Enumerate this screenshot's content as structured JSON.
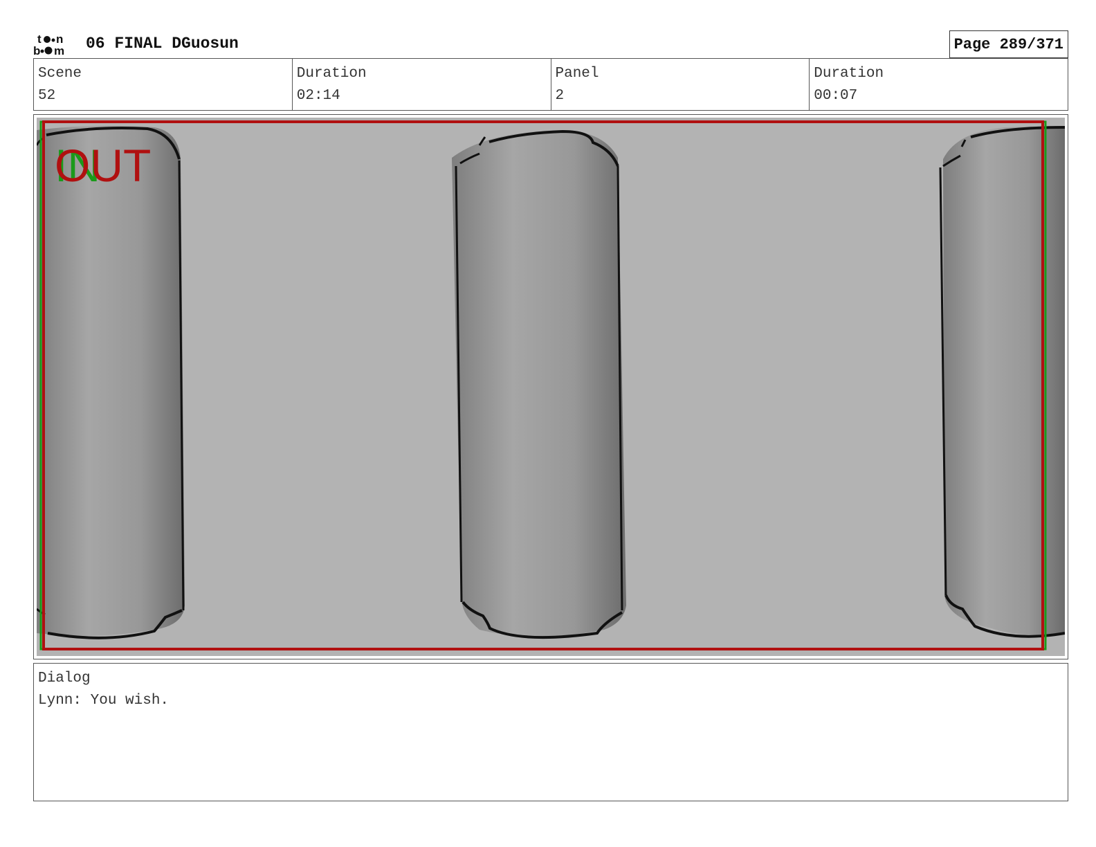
{
  "header": {
    "logo": "toon boom",
    "project_title": "06 FINAL DGuosun",
    "page": "Page 289/371"
  },
  "info": {
    "scene_label": "Scene",
    "scene_value": "52",
    "scene_duration_label": "Duration",
    "scene_duration_value": "02:14",
    "panel_label": "Panel",
    "panel_value": "2",
    "panel_duration_label": "Duration",
    "panel_duration_value": "00:07"
  },
  "panel": {
    "in_marker": "IN",
    "out_marker": "OUT",
    "background_color": "#b3b3b3",
    "frame_color": "#b01010",
    "in_color": "#1a9a1a"
  },
  "dialog": {
    "label": "Dialog",
    "text": "Lynn: You wish."
  }
}
